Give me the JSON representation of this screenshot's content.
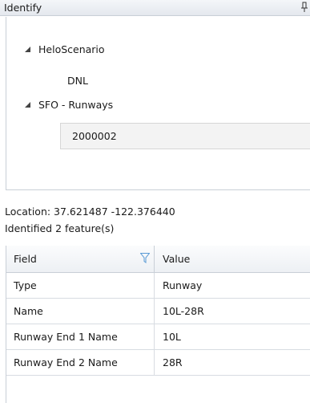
{
  "panel": {
    "title": "Identify"
  },
  "tree": {
    "layers": [
      {
        "name": "HeloScenario",
        "children": [
          "DNL"
        ]
      },
      {
        "name": "SFO - Runways",
        "children": [
          "2000002"
        ]
      }
    ]
  },
  "info": {
    "location": "Location: 37.621487 -122.376440",
    "identified": "Identified 2 feature(s)"
  },
  "grid": {
    "columns": [
      "Field",
      "Value"
    ],
    "rows": [
      {
        "field": "Type",
        "value": "Runway"
      },
      {
        "field": "Name",
        "value": "10L-28R"
      },
      {
        "field": "Runway End 1 Name",
        "value": "10L"
      },
      {
        "field": "Runway End 2 Name",
        "value": "28R"
      }
    ]
  },
  "colors": {
    "accent_filter": "#5a9bd5"
  }
}
